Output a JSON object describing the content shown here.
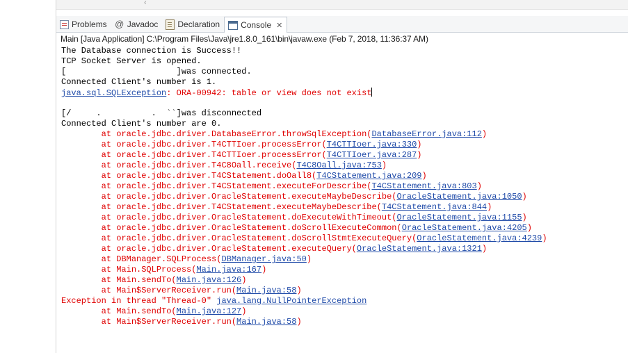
{
  "tabs": [
    {
      "label": "Problems",
      "icon": "problems-icon",
      "active": false
    },
    {
      "label": "Javadoc",
      "icon": "javadoc-icon",
      "active": false
    },
    {
      "label": "Declaration",
      "icon": "declaration-icon",
      "active": false
    },
    {
      "label": "Console",
      "icon": "console-icon",
      "active": true
    }
  ],
  "console_header": "Main [Java Application] C:\\Program Files\\Java\\jre1.8.0_161\\bin\\javaw.exe (Feb 7, 2018, 11:36:37 AM)",
  "colors": {
    "stderr": "#e00000",
    "link": "#1f4aa8",
    "stdout": "#000000"
  },
  "lines": [
    {
      "segs": [
        {
          "t": "The Database connection is Success!!"
        }
      ]
    },
    {
      "segs": [
        {
          "t": "TCP Socket Server is opened."
        }
      ]
    },
    {
      "segs": [
        {
          "t": "[                      ]was connected."
        }
      ]
    },
    {
      "segs": [
        {
          "t": "Connected Client's number is 1."
        }
      ]
    },
    {
      "segs": [
        {
          "t": "java.sql.SQLException",
          "c": "lnk"
        },
        {
          "t": ": ORA-00942: table or view does not exist",
          "c": "err"
        }
      ],
      "caret": true
    },
    {
      "segs": [
        {
          "t": ""
        }
      ]
    },
    {
      "segs": [
        {
          "t": "[/     .          .  ``]was disconnected"
        }
      ]
    },
    {
      "segs": [
        {
          "t": "Connected Client's number are 0."
        }
      ]
    },
    {
      "segs": [
        {
          "t": "\tat oracle.jdbc.driver.DatabaseError.throwSqlException(",
          "c": "err"
        },
        {
          "t": "DatabaseError.java:112",
          "c": "lnk"
        },
        {
          "t": ")",
          "c": "err"
        }
      ]
    },
    {
      "segs": [
        {
          "t": "\tat oracle.jdbc.driver.T4CTTIoer.processError(",
          "c": "err"
        },
        {
          "t": "T4CTTIoer.java:330",
          "c": "lnk"
        },
        {
          "t": ")",
          "c": "err"
        }
      ]
    },
    {
      "segs": [
        {
          "t": "\tat oracle.jdbc.driver.T4CTTIoer.processError(",
          "c": "err"
        },
        {
          "t": "T4CTTIoer.java:287",
          "c": "lnk"
        },
        {
          "t": ")",
          "c": "err"
        }
      ]
    },
    {
      "segs": [
        {
          "t": "\tat oracle.jdbc.driver.T4C8Oall.receive(",
          "c": "err"
        },
        {
          "t": "T4C8Oall.java:753",
          "c": "lnk"
        },
        {
          "t": ")",
          "c": "err"
        }
      ]
    },
    {
      "segs": [
        {
          "t": "\tat oracle.jdbc.driver.T4CStatement.doOall8(",
          "c": "err"
        },
        {
          "t": "T4CStatement.java:209",
          "c": "lnk"
        },
        {
          "t": ")",
          "c": "err"
        }
      ]
    },
    {
      "segs": [
        {
          "t": "\tat oracle.jdbc.driver.T4CStatement.executeForDescribe(",
          "c": "err"
        },
        {
          "t": "T4CStatement.java:803",
          "c": "lnk"
        },
        {
          "t": ")",
          "c": "err"
        }
      ]
    },
    {
      "segs": [
        {
          "t": "\tat oracle.jdbc.driver.OracleStatement.executeMaybeDescribe(",
          "c": "err"
        },
        {
          "t": "OracleStatement.java:1050",
          "c": "lnk"
        },
        {
          "t": ")",
          "c": "err"
        }
      ]
    },
    {
      "segs": [
        {
          "t": "\tat oracle.jdbc.driver.T4CStatement.executeMaybeDescribe(",
          "c": "err"
        },
        {
          "t": "T4CStatement.java:844",
          "c": "lnk"
        },
        {
          "t": ")",
          "c": "err"
        }
      ]
    },
    {
      "segs": [
        {
          "t": "\tat oracle.jdbc.driver.OracleStatement.doExecuteWithTimeout(",
          "c": "err"
        },
        {
          "t": "OracleStatement.java:1155",
          "c": "lnk"
        },
        {
          "t": ")",
          "c": "err"
        }
      ]
    },
    {
      "segs": [
        {
          "t": "\tat oracle.jdbc.driver.OracleStatement.doScrollExecuteCommon(",
          "c": "err"
        },
        {
          "t": "OracleStatement.java:4205",
          "c": "lnk"
        },
        {
          "t": ")",
          "c": "err"
        }
      ]
    },
    {
      "segs": [
        {
          "t": "\tat oracle.jdbc.driver.OracleStatement.doScrollStmtExecuteQuery(",
          "c": "err"
        },
        {
          "t": "OracleStatement.java:4239",
          "c": "lnk"
        },
        {
          "t": ")",
          "c": "err"
        }
      ]
    },
    {
      "segs": [
        {
          "t": "\tat oracle.jdbc.driver.OracleStatement.executeQuery(",
          "c": "err"
        },
        {
          "t": "OracleStatement.java:1321",
          "c": "lnk"
        },
        {
          "t": ")",
          "c": "err"
        }
      ]
    },
    {
      "segs": [
        {
          "t": "\tat DBManager.SQLProcess(",
          "c": "err"
        },
        {
          "t": "DBManager.java:50",
          "c": "lnk"
        },
        {
          "t": ")",
          "c": "err"
        }
      ]
    },
    {
      "segs": [
        {
          "t": "\tat Main.SQLProcess(",
          "c": "err"
        },
        {
          "t": "Main.java:167",
          "c": "lnk"
        },
        {
          "t": ")",
          "c": "err"
        }
      ]
    },
    {
      "segs": [
        {
          "t": "\tat Main.sendTo(",
          "c": "err"
        },
        {
          "t": "Main.java:126",
          "c": "lnk"
        },
        {
          "t": ")",
          "c": "err"
        }
      ]
    },
    {
      "segs": [
        {
          "t": "\tat Main$ServerReceiver.run(",
          "c": "err"
        },
        {
          "t": "Main.java:58",
          "c": "lnk"
        },
        {
          "t": ")",
          "c": "err"
        }
      ]
    },
    {
      "segs": [
        {
          "t": "Exception in thread \"Thread-0\" ",
          "c": "err"
        },
        {
          "t": "java.lang.NullPointerException",
          "c": "lnk"
        }
      ]
    },
    {
      "segs": [
        {
          "t": "\tat Main.sendTo(",
          "c": "err"
        },
        {
          "t": "Main.java:127",
          "c": "lnk"
        },
        {
          "t": ")",
          "c": "err"
        }
      ]
    },
    {
      "segs": [
        {
          "t": "\tat Main$ServerReceiver.run(",
          "c": "err"
        },
        {
          "t": "Main.java:58",
          "c": "lnk"
        },
        {
          "t": ")",
          "c": "err"
        }
      ]
    }
  ]
}
